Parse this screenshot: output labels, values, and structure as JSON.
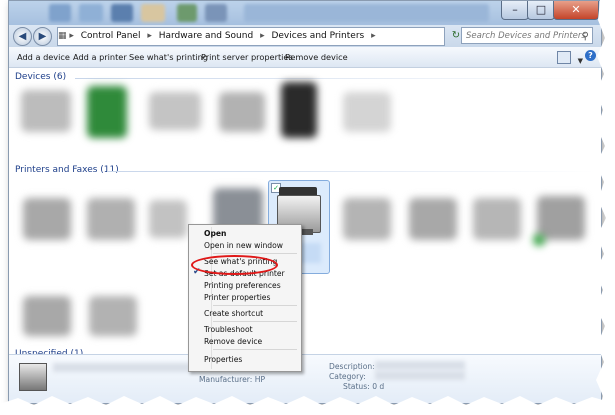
{
  "address": {
    "breadcrumbs": [
      "Control Panel",
      "Hardware and Sound",
      "Devices and Printers"
    ],
    "search_placeholder": "Search Devices and Printers"
  },
  "toolbar": {
    "add_device": "Add a device",
    "add_printer": "Add a printer",
    "see_printing": "See what's printing",
    "server_props": "Print server properties",
    "remove_device": "Remove device"
  },
  "groups": {
    "devices": "Devices (6)",
    "printers": "Printers and Faxes (11)",
    "unspecified": "Unspecified (1)"
  },
  "context_menu": {
    "items": [
      "Open",
      "Open in new window",
      "See what's printing",
      "Set as default printer",
      "Printing preferences",
      "Printer properties",
      "Create shortcut",
      "Troubleshoot",
      "Remove device",
      "Properties"
    ],
    "checked_index": 3,
    "highlighted_index": 2
  },
  "details": {
    "description_label": "Description:",
    "category_label": "Category:",
    "status_label": "Status:",
    "manufacturer_label": "Manufacturer:",
    "manufacturer_value": "HP",
    "status_value": "0 d"
  },
  "colors": {
    "highlight": "#e01818",
    "accent": "#1e3f8a"
  }
}
